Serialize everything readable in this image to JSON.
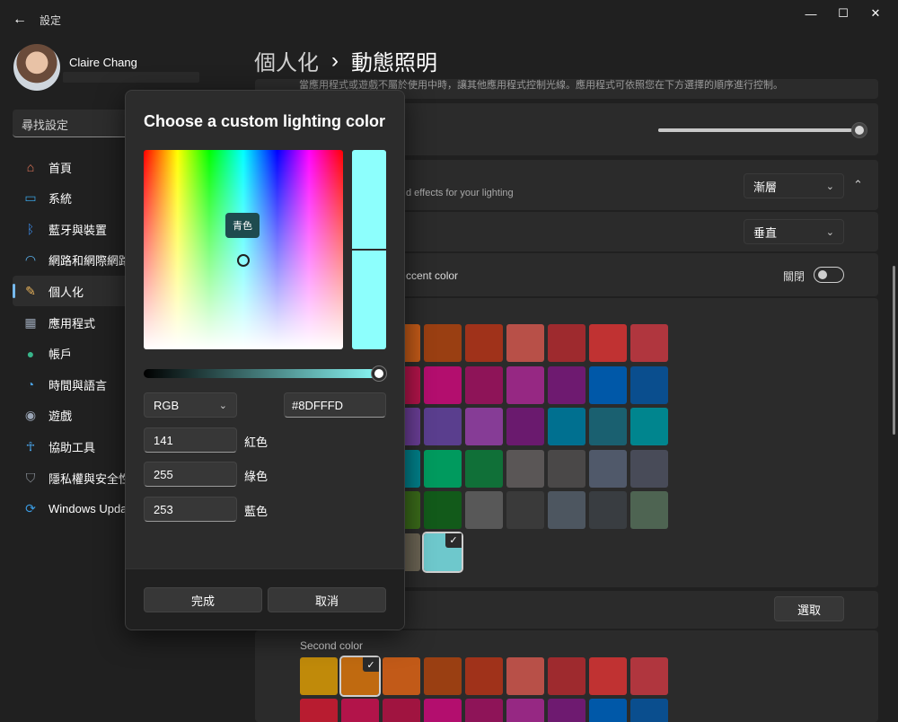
{
  "window": {
    "app_title": "設定",
    "minimize": "—",
    "maximize": "☐",
    "close": "✕"
  },
  "user": {
    "name": "Claire Chang"
  },
  "search": {
    "placeholder": "尋找設定"
  },
  "sidebar": {
    "items": [
      {
        "label": "首頁",
        "icon": "home-icon",
        "glyph": "⌂",
        "color": "#e8795b"
      },
      {
        "label": "系統",
        "icon": "monitor-icon",
        "glyph": "▭",
        "color": "#3aa0e0"
      },
      {
        "label": "藍牙與裝置",
        "icon": "bluetooth-icon",
        "glyph": "ᛒ",
        "color": "#3a86e0"
      },
      {
        "label": "網路和網際網路",
        "icon": "wifi-icon",
        "glyph": "◠",
        "color": "#5bb4f0"
      },
      {
        "label": "個人化",
        "icon": "brush-icon",
        "glyph": "✎",
        "color": "#e8b35b"
      },
      {
        "label": "應用程式",
        "icon": "apps-icon",
        "glyph": "▦",
        "color": "#9aa5b5"
      },
      {
        "label": "帳戶",
        "icon": "person-icon",
        "glyph": "●",
        "color": "#38b58a"
      },
      {
        "label": "時間與語言",
        "icon": "globe-icon",
        "glyph": "◔",
        "color": "#4aa0e0"
      },
      {
        "label": "遊戲",
        "icon": "gamepad-icon",
        "glyph": "◉",
        "color": "#9aa5b5"
      },
      {
        "label": "協助工具",
        "icon": "accessibility-icon",
        "glyph": "☥",
        "color": "#4aa8f0"
      },
      {
        "label": "隱私權與安全性",
        "icon": "shield-icon",
        "glyph": "⛉",
        "color": "#8a9098"
      },
      {
        "label": "Windows Update",
        "icon": "update-icon",
        "glyph": "⟳",
        "color": "#3a9ae0"
      }
    ]
  },
  "breadcrumb": {
    "parent": "個人化",
    "separator": "›",
    "current": "動態照明"
  },
  "main": {
    "description": "當應用程式或遊戲不屬於使用中時，讓其他應用程式控制光線。應用程式可依照您在下方選擇的順序進行控制。",
    "effects_desc": "d effects for your lighting",
    "effect_combo": "漸層",
    "direction_combo": "垂直",
    "accent_label": "ccent color",
    "toggle_label": "關閉",
    "select_button": "選取",
    "second_color_label": "Second color"
  },
  "swatches": {
    "first_color_rows": [
      [
        "#c25a18",
        "#9a3f12",
        "#a0321a",
        "#b85048",
        "#9e2a2e",
        "#c03232",
        "#b0363e"
      ],
      [
        "#b2144a",
        "#b30e6e",
        "#8e1458",
        "#962883",
        "#6e1a70",
        "#0058a8",
        "#0a4e8e"
      ],
      [
        "#6a3e96",
        "#5a3e8e",
        "#863c96",
        "#6a1a6e",
        "#007090",
        "#1a6070",
        "#00858e"
      ],
      [
        "#00808a",
        "#009a5e",
        "#107038",
        "#5a5656",
        "#4a4848",
        "#50596a",
        "#484b58"
      ],
      [
        "#3a6a1a",
        "#125a1a",
        "#585858",
        "#3a3a3a",
        "#4d5660",
        "#393d41",
        "#4e6452"
      ],
      [
        "#6b6454",
        "#6ec8cc"
      ]
    ],
    "second_color_rows": [
      [
        "#c08a0a",
        "#c06a10",
        "#c25a18",
        "#9a3f12",
        "#a0321a",
        "#b85048",
        "#9e2a2e",
        "#c03232",
        "#b0363e"
      ],
      [
        "#b81c30",
        "#b2144a",
        "#a01440",
        "#b30e6e",
        "#8e1458",
        "#962883",
        "#6e1a70",
        "#0058a8",
        "#0a4e8e"
      ]
    ]
  },
  "dialog": {
    "title": "Choose a custom lighting color",
    "tooltip": "青色",
    "preview_color": "#8DFFFD",
    "mode": "RGB",
    "hex": "#8DFFFD",
    "red_value": "141",
    "red_label": "紅色",
    "green_value": "255",
    "green_label": "綠色",
    "blue_value": "253",
    "blue_label": "藍色",
    "ok_button": "完成",
    "cancel_button": "取消"
  }
}
